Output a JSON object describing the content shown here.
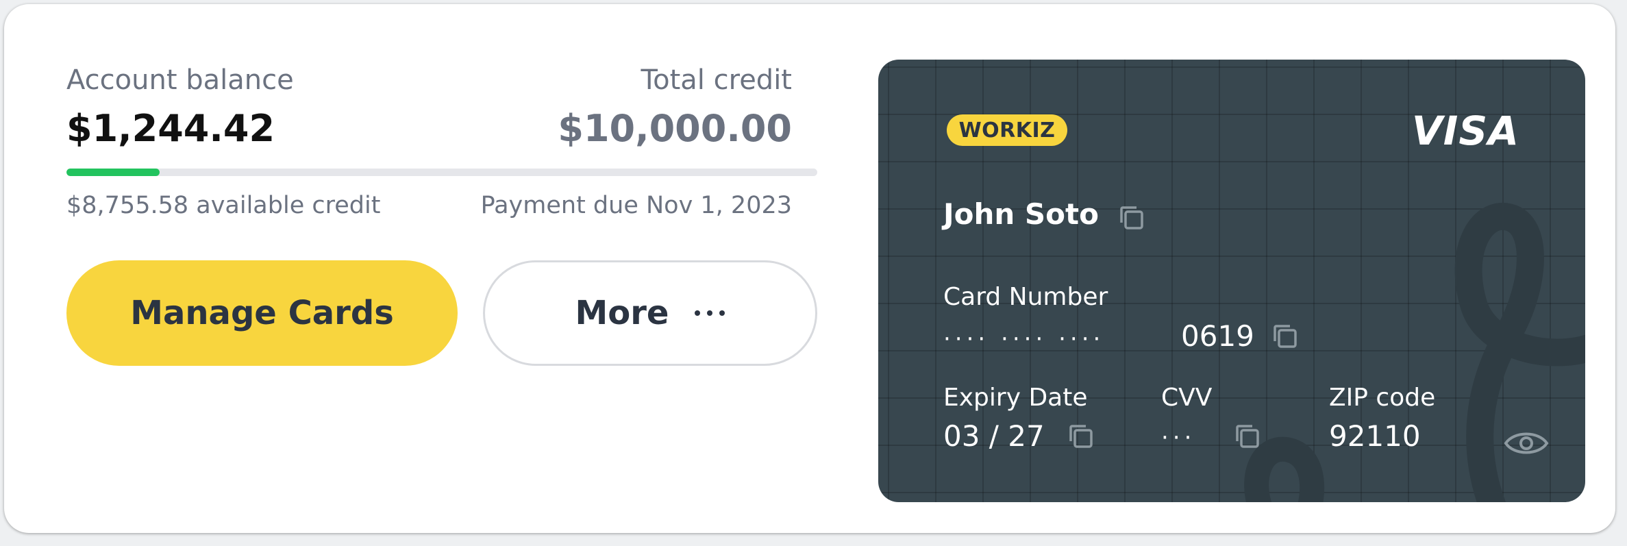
{
  "summary": {
    "balance_label": "Account balance",
    "balance_value": "$1,244.42",
    "credit_label": "Total credit",
    "credit_value": "$10,000.00",
    "usage_fraction": 0.1244,
    "available_text": "$8,755.58 available credit",
    "payment_due_text": "Payment due Nov 1, 2023"
  },
  "actions": {
    "manage_label": "Manage Cards",
    "more_label": "More"
  },
  "card": {
    "brand_label": "WORKIZ",
    "network_label": "VISA",
    "holder_name": "John Soto",
    "number_label": "Card Number",
    "number_masked": "···· ···· ····",
    "number_last4": "0619",
    "expiry_label": "Expiry Date",
    "expiry_value": "03 / 27",
    "cvv_label": "CVV",
    "cvv_masked": "···",
    "zip_label": "ZIP code",
    "zip_value": "92110"
  },
  "colors": {
    "accent_yellow": "#f8d53e",
    "progress_green": "#22c35e",
    "card_background": "#38474f",
    "muted_text": "#6b7280"
  },
  "icons": [
    "copy-icon",
    "eye-icon",
    "more-dots-icon"
  ]
}
